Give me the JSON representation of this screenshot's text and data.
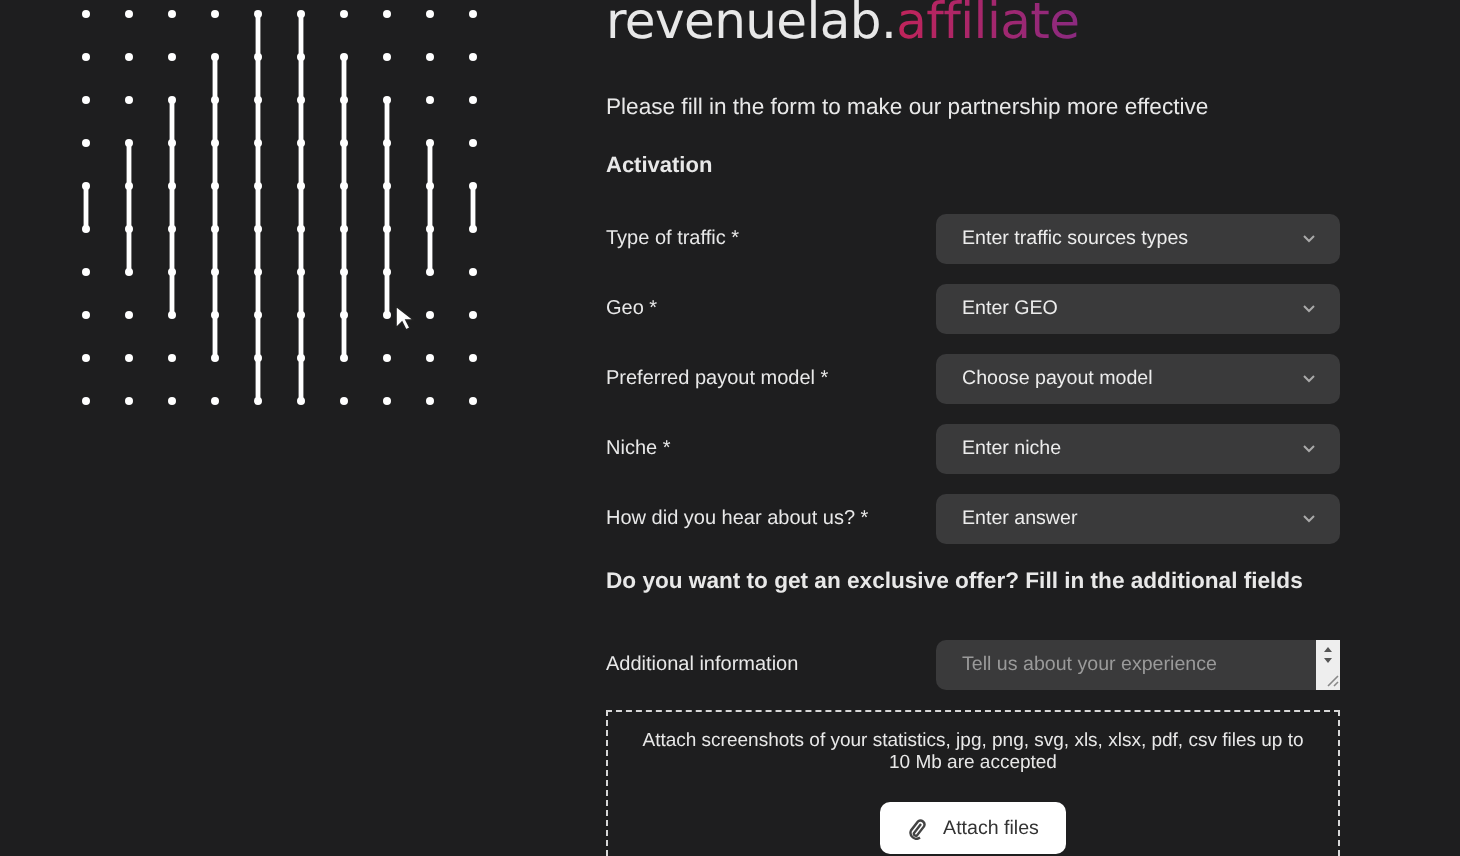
{
  "logo": {
    "main": "revenuelab.",
    "accent": "affiliate"
  },
  "intro": "Please fill in the form to make our partnership more effective",
  "section_title": "Activation",
  "fields": [
    {
      "label": "Type of traffic *",
      "placeholder": "Enter traffic sources types",
      "kind": "select"
    },
    {
      "label": "Geo *",
      "placeholder": "Enter GEO",
      "kind": "select"
    },
    {
      "label": "Preferred payout model *",
      "placeholder": "Choose payout model",
      "kind": "select"
    },
    {
      "label": "Niche *",
      "placeholder": "Enter niche",
      "kind": "select"
    },
    {
      "label": "How did you hear about us? *",
      "placeholder": "Enter answer",
      "kind": "select"
    }
  ],
  "extra_title": "Do you want to get an exclusive offer? Fill in the additional fields",
  "extra_fields": [
    {
      "label": "Additional information",
      "placeholder": "Tell us about your experience",
      "kind": "textarea"
    }
  ],
  "upload": {
    "hint": "Attach screenshots of your statistics, jpg, png, svg, xls, xlsx, pdf, csv files up to 10 Mb are accepted",
    "button": "Attach files"
  }
}
